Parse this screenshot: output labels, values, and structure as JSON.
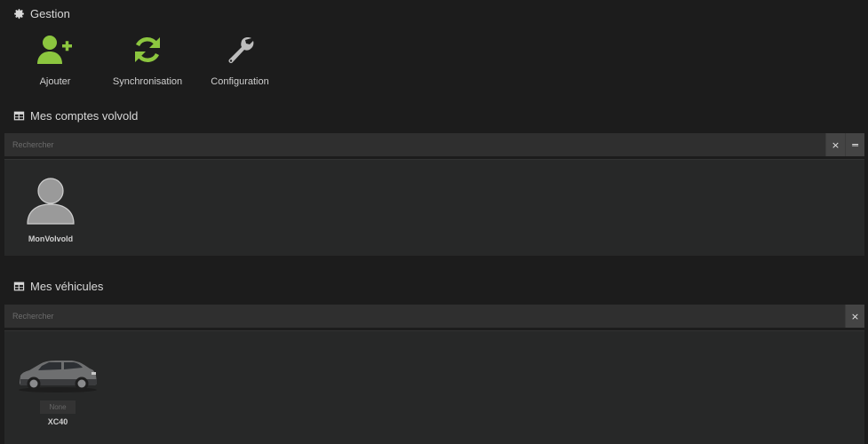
{
  "gestion": {
    "title": "Gestion",
    "actions": [
      {
        "label": "Ajouter",
        "icon": "user-plus-icon"
      },
      {
        "label": "Synchronisation",
        "icon": "refresh-icon"
      },
      {
        "label": "Configuration",
        "icon": "wrench-icon"
      }
    ]
  },
  "comptes": {
    "title": "Mes comptes volvold",
    "search_placeholder": "Rechercher",
    "clear_button": "×",
    "collapse_button": "═",
    "items": [
      {
        "name": "MonVolvold",
        "icon": "user-avatar-icon"
      }
    ]
  },
  "vehicules": {
    "title": "Mes véhicules",
    "search_placeholder": "Rechercher",
    "clear_button": "×",
    "items": [
      {
        "name": "XC40",
        "badge": "None",
        "icon": "car-icon"
      }
    ]
  },
  "colors": {
    "accent_green": "#8cc63f",
    "icon_grey": "#bdbdbd",
    "background": "#1c1c1c",
    "panel": "#272828"
  }
}
